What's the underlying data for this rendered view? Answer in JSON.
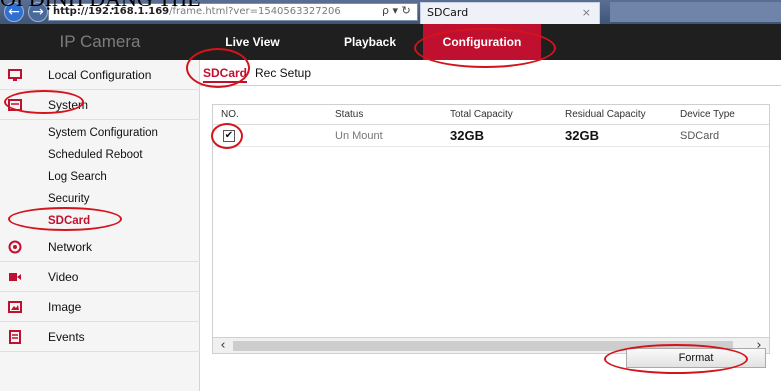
{
  "top_heading": "ƠI ĐỊNH DẠNG THẺ",
  "browser": {
    "url_host": "http://192.168.1.169",
    "url_path": "/frame.html?ver=1540563327206",
    "address_tools": "ρ ▾ ↻",
    "tab_title": "SDCard",
    "tab_close": "×"
  },
  "header": {
    "brand": "IP Camera",
    "menu": [
      "Live View",
      "Playback",
      "Configuration"
    ]
  },
  "sidebar": {
    "local_configuration": "Local Configuration",
    "system": "System",
    "system_items": [
      "System Configuration",
      "Scheduled Reboot",
      "Log Search",
      "Security",
      "SDCard"
    ],
    "network": "Network",
    "video": "Video",
    "image": "Image",
    "events": "Events"
  },
  "subtabs": [
    "SDCard",
    "Rec Setup"
  ],
  "table": {
    "headers": [
      "NO.",
      "Status",
      "Total Capacity",
      "Residual Capacity",
      "Device Type"
    ],
    "rows": [
      {
        "checked": "✔",
        "status": "Un Mount",
        "total": "32GB",
        "residual": "32GB",
        "device_type": "SDCard"
      }
    ]
  },
  "format_button": "Format",
  "colors": {
    "accent": "#c0102f",
    "annotation": "#d4141c",
    "header_bg": "#1f1f1f"
  },
  "icons": {
    "monitor": "monitor-icon",
    "system": "system-icon",
    "network": "globe-icon",
    "video": "video-icon",
    "image": "image-icon",
    "events": "events-icon"
  }
}
